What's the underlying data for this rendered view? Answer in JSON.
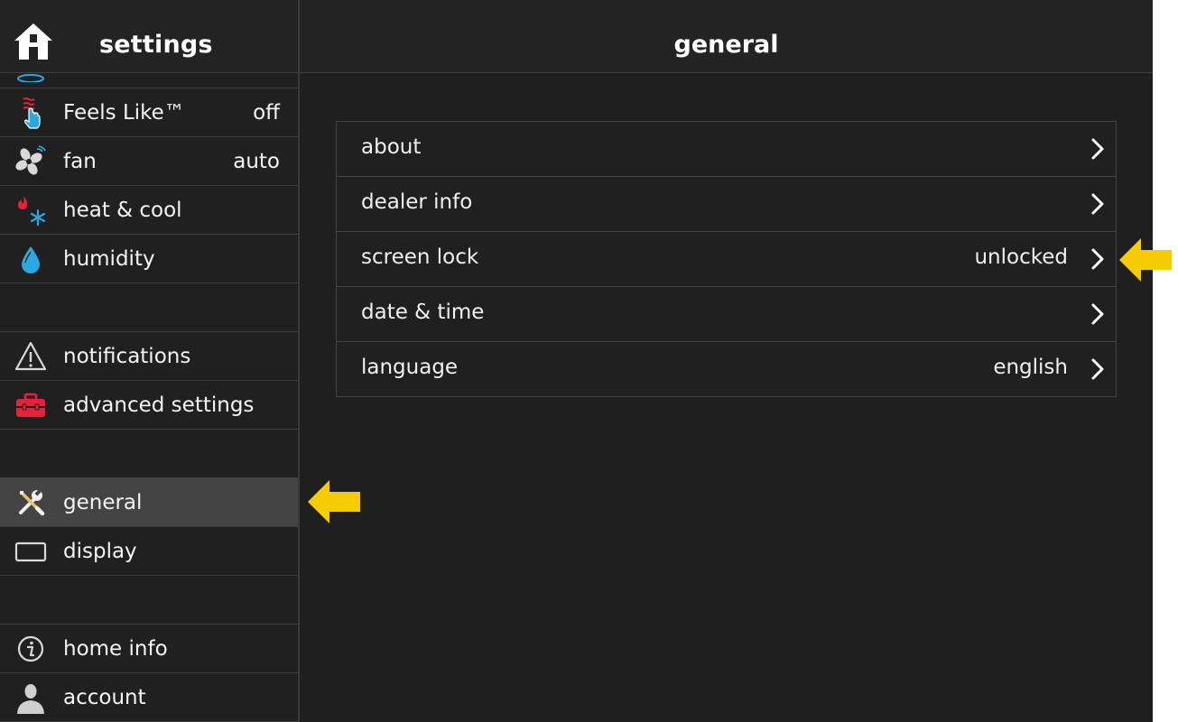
{
  "sidebar": {
    "title": "settings",
    "items": [
      {
        "label": "Feels Like™",
        "value": "off",
        "icon": "feels-like-icon"
      },
      {
        "label": "fan",
        "value": "auto",
        "icon": "fan-icon"
      },
      {
        "label": "heat & cool",
        "value": "",
        "icon": "heat-cool-icon"
      },
      {
        "label": "humidity",
        "value": "",
        "icon": "humidity-icon"
      },
      {
        "label": "notifications",
        "value": "",
        "icon": "warning-icon"
      },
      {
        "label": "advanced settings",
        "value": "",
        "icon": "toolbox-icon"
      },
      {
        "label": "general",
        "value": "",
        "icon": "wrench-screwdriver-icon",
        "active": true
      },
      {
        "label": "display",
        "value": "",
        "icon": "display-icon"
      },
      {
        "label": "home info",
        "value": "",
        "icon": "info-icon"
      },
      {
        "label": "account",
        "value": "",
        "icon": "account-icon"
      }
    ]
  },
  "main": {
    "title": "general",
    "rows": [
      {
        "label": "about",
        "value": ""
      },
      {
        "label": "dealer info",
        "value": ""
      },
      {
        "label": "screen lock",
        "value": "unlocked"
      },
      {
        "label": "date & time",
        "value": ""
      },
      {
        "label": "language",
        "value": "english"
      }
    ]
  },
  "colors": {
    "background": "#202020",
    "active_row": "#444444",
    "annotation_arrow": "#f5cc00",
    "accent_blue": "#2aa8e0",
    "accent_red": "#e8213a"
  }
}
